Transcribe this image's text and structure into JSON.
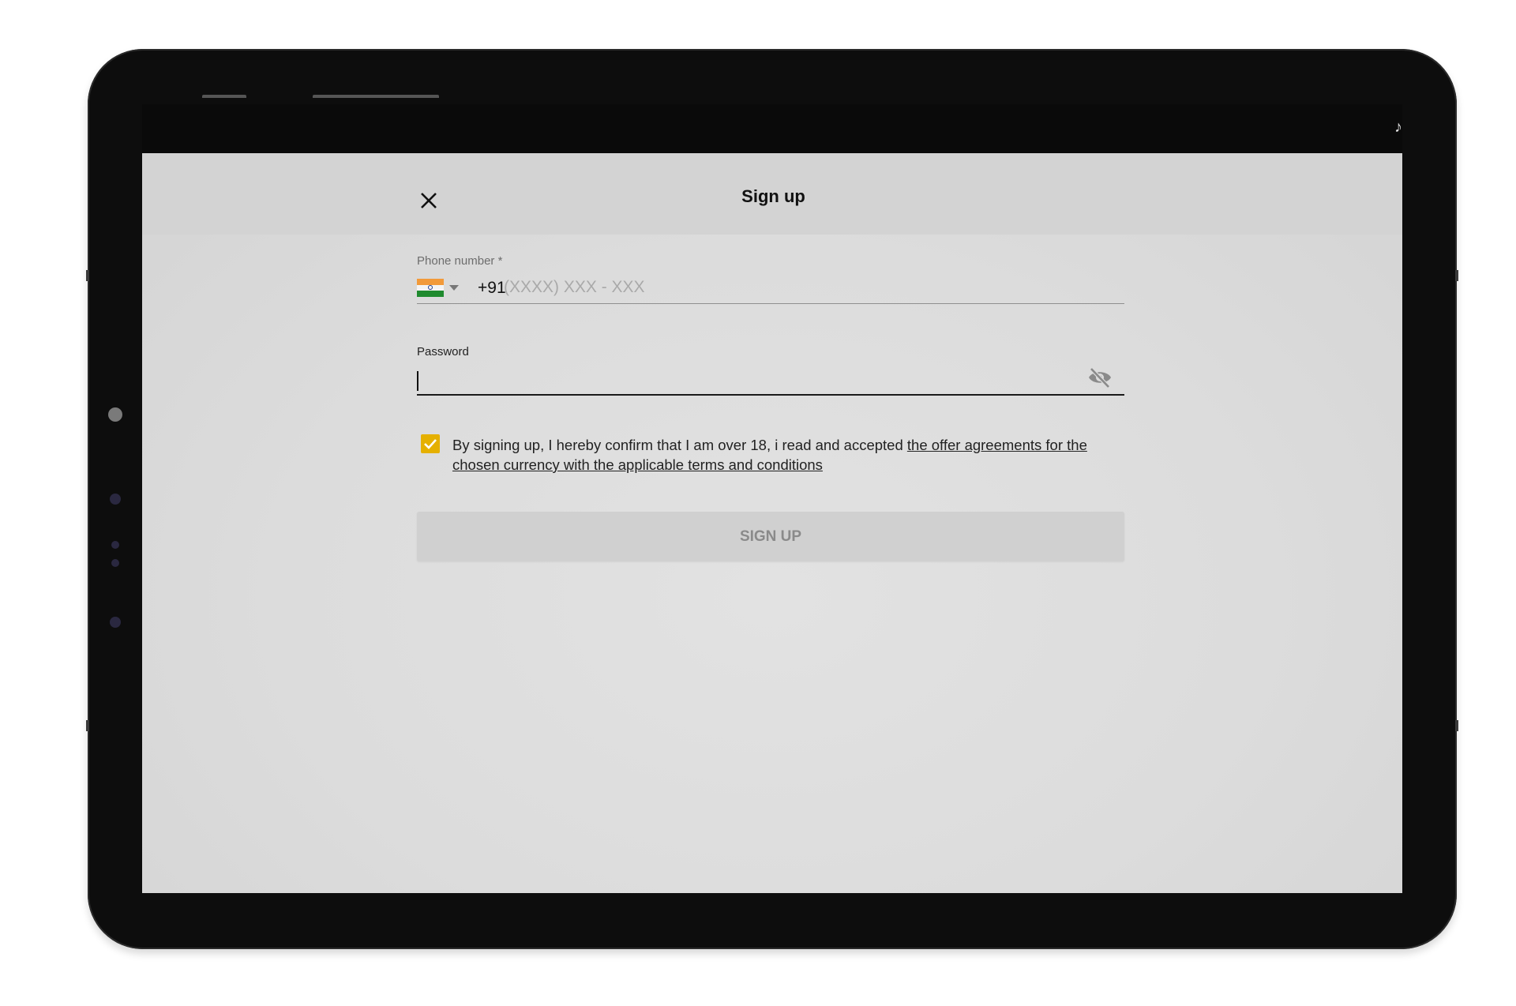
{
  "device": {
    "status_glyph": "♪"
  },
  "header": {
    "title": "Sign up",
    "close_icon": "close-icon"
  },
  "phone": {
    "label": "Phone number *",
    "country_icon": "india-flag-icon",
    "prefix": "+91",
    "placeholder": "(XXXX) XXX - XXX",
    "value": ""
  },
  "password": {
    "label": "Password",
    "value": "",
    "visibility_icon": "eye-off-icon"
  },
  "consent": {
    "checked": true,
    "text": "By signing up, I hereby confirm that I am over 18, i read and accepted ",
    "link_text": "the offer agreements for the chosen currency with the applicable terms and conditions"
  },
  "submit": {
    "label": "SIGN UP"
  },
  "colors": {
    "accent_checkbox": "#e5b000",
    "header_bg": "#d3d3d3",
    "button_bg": "#d0d0d0",
    "button_text": "#8a8a8a"
  }
}
